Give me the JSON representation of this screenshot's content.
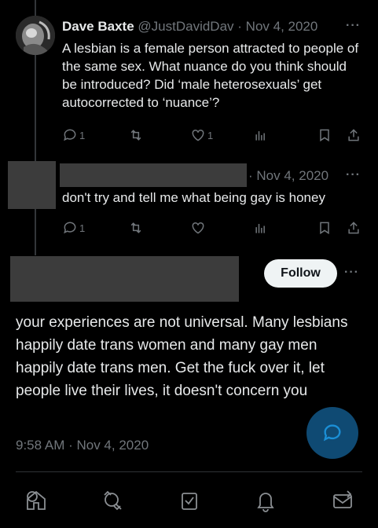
{
  "tweet1": {
    "name": "Dave Baxte",
    "handle": "@JustDavidDav",
    "date": "· Nov 4, 2020",
    "more": "···",
    "text": "A lesbian is a female person attracted to people of the same sex. What nuance do you think should be introduced? Did ‘male heterosexuals’ get autocorrected to ‘nuance’?",
    "reply_count": "1",
    "like_count": "1"
  },
  "tweet2": {
    "date": "· Nov 4, 2020",
    "more": "···",
    "text": "don't try and tell me what being gay is honey",
    "reply_count": "1"
  },
  "main_tweet": {
    "follow_label": "Follow",
    "more": "···",
    "text": "your experiences are not universal. Many lesbians happily date trans women and many gay men happily date trans men. Get the fuck over it, let people live their lives, it doesn't concern you",
    "timestamp": "9:58 AM · Nov 4, 2020"
  },
  "nav": {
    "items": [
      "home-icon",
      "explore-icon",
      "communities-icon",
      "notifications-icon",
      "messages-icon"
    ]
  },
  "colors": {
    "background": "#000000",
    "text": "#e7e9ea",
    "muted": "#71767b",
    "fab": "#0f4a73",
    "follow_bg": "#eff3f4"
  }
}
